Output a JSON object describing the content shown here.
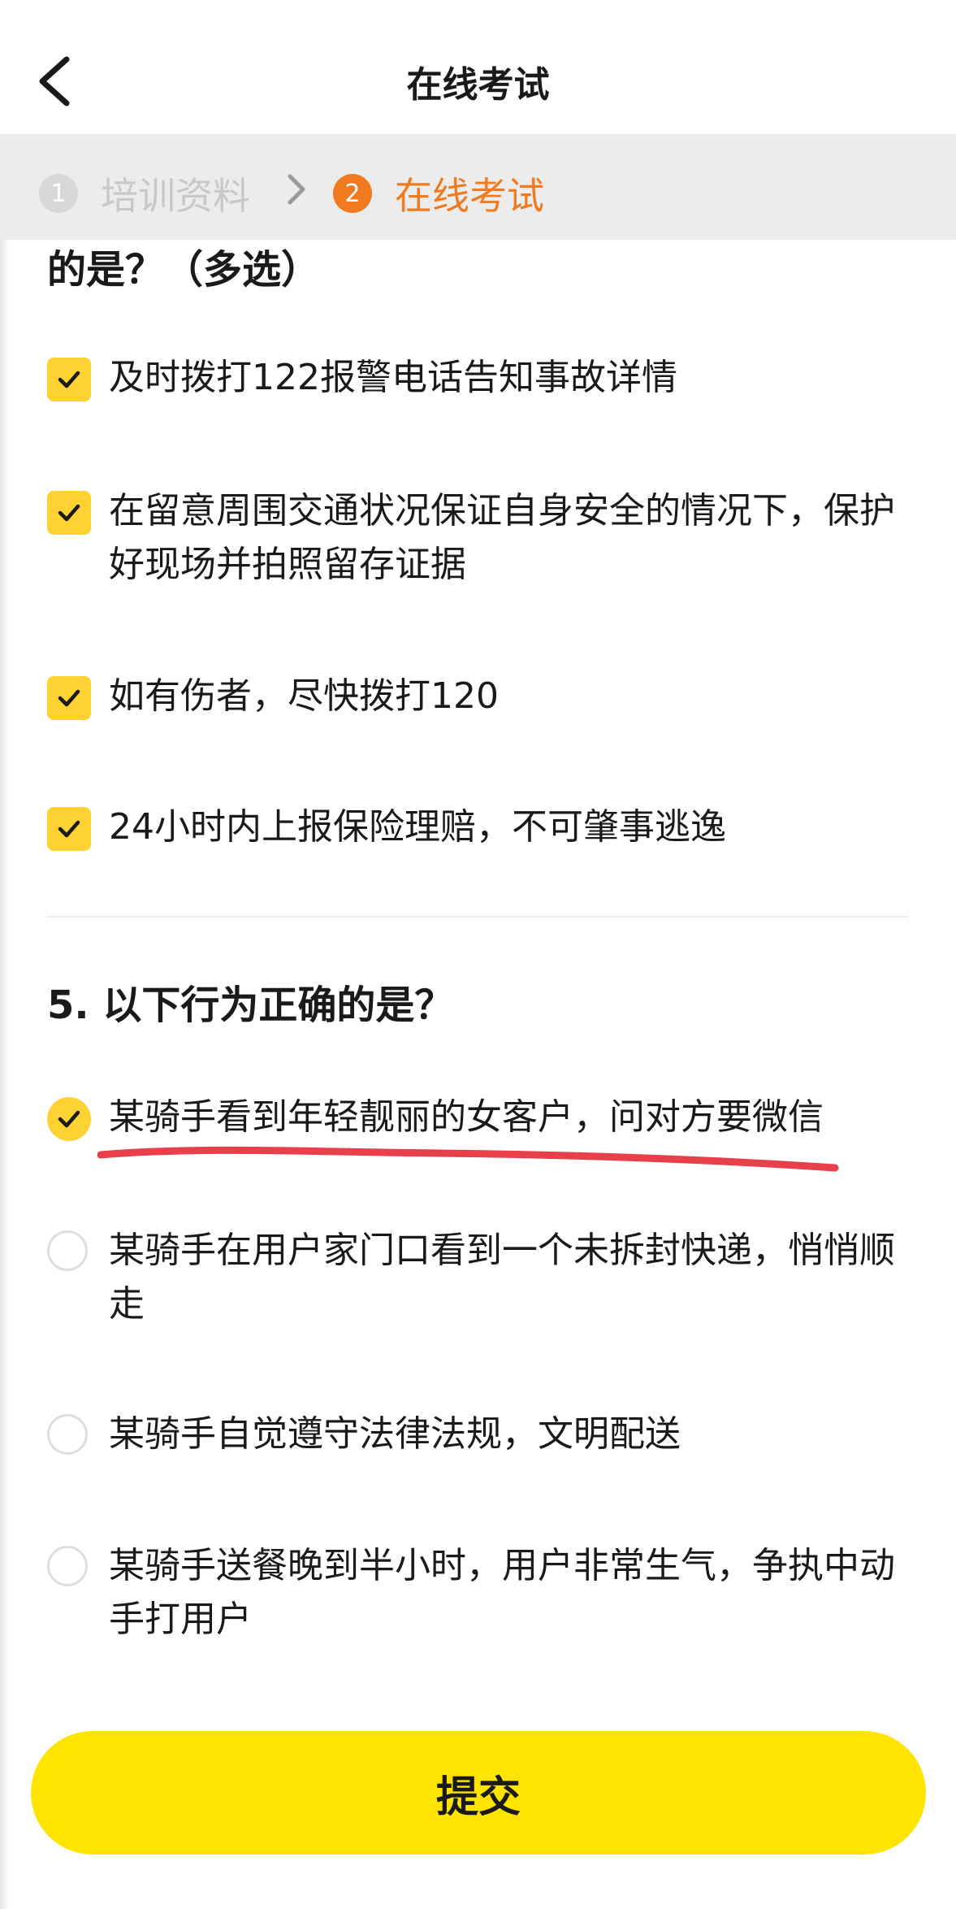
{
  "nav": {
    "title": "在线考试"
  },
  "steps": [
    {
      "number": "1",
      "label": "培训资料",
      "active": false
    },
    {
      "number": "2",
      "label": "在线考试",
      "active": true
    }
  ],
  "question_4": {
    "title_tail": "的是？（多选）",
    "options": [
      {
        "text": "及时拨打122报警电话告知事故详情",
        "checked": true
      },
      {
        "text": "在留意周围交通状况保证自身安全的情况下，保护好现场并拍照留存证据",
        "checked": true
      },
      {
        "text": "如有伤者，尽快拨打120",
        "checked": true
      },
      {
        "text": "24小时内上报保险理赔，不可肇事逃逸",
        "checked": true
      }
    ]
  },
  "question_5": {
    "title": "5. 以下行为正确的是？",
    "options": [
      {
        "text": "某骑手看到年轻靓丽的女客户，问对方要微信",
        "checked": true
      },
      {
        "text": "某骑手在用户家门口看到一个未拆封快递，悄悄顺走",
        "checked": false
      },
      {
        "text": "某骑手自觉遵守法律法规，文明配送",
        "checked": false
      },
      {
        "text": "某骑手送餐晚到半小时，用户非常生气，争执中动手打用户",
        "checked": false
      }
    ]
  },
  "submit": {
    "label": "提交"
  },
  "colors": {
    "accent_yellow": "#ffd233",
    "button_yellow": "#ffe400",
    "step_active_orange": "#f07a1f",
    "annotation_red": "#e8404a"
  },
  "icons": {
    "back": "chevron-left-icon",
    "step_separator": "chevron-right-icon",
    "check": "checkmark-icon"
  }
}
